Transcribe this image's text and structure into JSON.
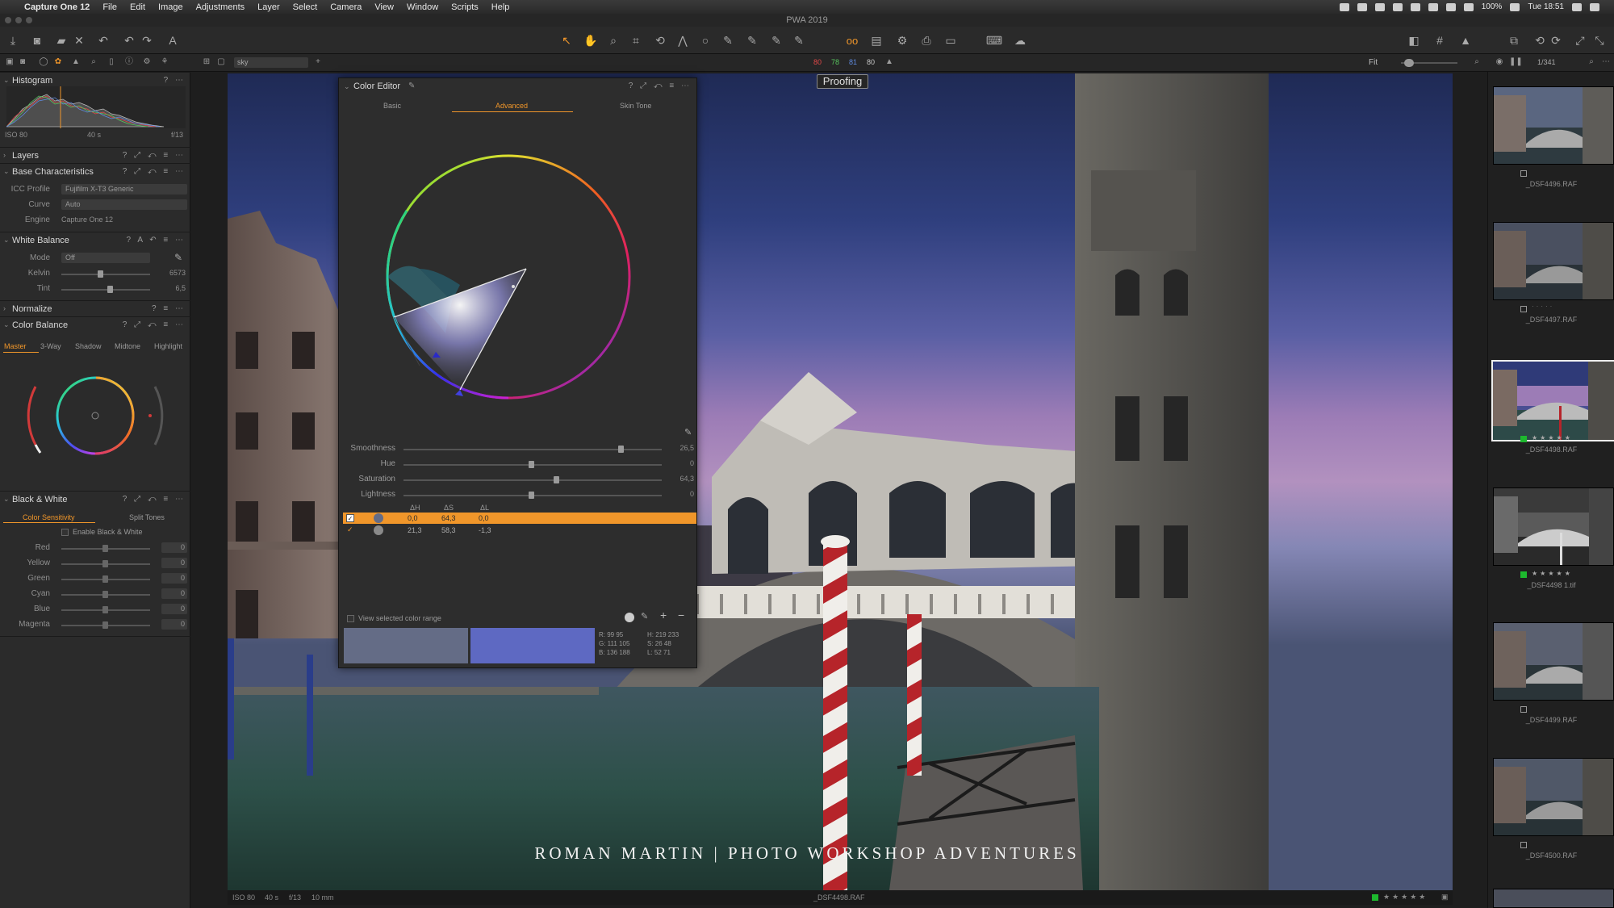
{
  "menubar": {
    "app_name": "Capture One 12",
    "items": [
      "File",
      "Edit",
      "Image",
      "Adjustments",
      "Layer",
      "Select",
      "Camera",
      "View",
      "Window",
      "Scripts",
      "Help"
    ],
    "battery": "100%",
    "clock": "Tue 18:51"
  },
  "window": {
    "title": "PWA 2019"
  },
  "subbar": {
    "search_value": "sky",
    "clip_values": [
      "80",
      "78",
      "81",
      "80"
    ],
    "zoom_label": "Fit",
    "count": "1/341"
  },
  "histogram": {
    "title": "Histogram",
    "iso": "ISO 80",
    "shutter": "40 s",
    "aperture": "f/13"
  },
  "layers": {
    "title": "Layers"
  },
  "base_characteristics": {
    "title": "Base Characteristics",
    "icc_label": "ICC Profile",
    "icc_value": "Fujifilm X-T3 Generic",
    "curve_label": "Curve",
    "curve_value": "Auto",
    "engine_label": "Engine",
    "engine_value": "Capture One 12"
  },
  "white_balance": {
    "title": "White Balance",
    "mode_label": "Mode",
    "mode_value": "Off",
    "kelvin_label": "Kelvin",
    "kelvin_value": "6573",
    "tint_label": "Tint",
    "tint_value": "6,5"
  },
  "normalize": {
    "title": "Normalize"
  },
  "color_balance": {
    "title": "Color Balance",
    "tabs": [
      "Master",
      "3-Way",
      "Shadow",
      "Midtone",
      "Highlight"
    ]
  },
  "black_white": {
    "title": "Black & White",
    "tabs": [
      "Color Sensitivity",
      "Split Tones"
    ],
    "enable_label": "Enable Black & White",
    "rows": [
      {
        "label": "Red",
        "value": "0"
      },
      {
        "label": "Yellow",
        "value": "0"
      },
      {
        "label": "Green",
        "value": "0"
      },
      {
        "label": "Cyan",
        "value": "0"
      },
      {
        "label": "Blue",
        "value": "0"
      },
      {
        "label": "Magenta",
        "value": "0"
      }
    ]
  },
  "proofing": {
    "label": "Proofing"
  },
  "color_editor": {
    "title": "Color Editor",
    "tabs": [
      "Basic",
      "Advanced",
      "Skin Tone"
    ],
    "sliders": [
      {
        "label": "Smoothness",
        "value": "26,5"
      },
      {
        "label": "Hue",
        "value": "0"
      },
      {
        "label": "Saturation",
        "value": "64,3"
      },
      {
        "label": "Lightness",
        "value": "0"
      }
    ],
    "columns": [
      "ΔH",
      "ΔS",
      "ΔL"
    ],
    "rows": [
      {
        "dh": "0,0",
        "ds": "64,3",
        "dl": "0,0"
      },
      {
        "dh": "21,3",
        "ds": "58,3",
        "dl": "-1,3"
      }
    ],
    "view_selected_label": "View selected color range",
    "readout": {
      "r": "R: 99  95",
      "g": "G: 111 105",
      "b": "B: 136 188",
      "h": "H: 219 233",
      "s": "S: 26  48",
      "l": "L: 52  71"
    },
    "swatch_before": "#646c86",
    "swatch_after": "#5e69c2"
  },
  "viewer_status": {
    "iso": "ISO 80",
    "shutter": "40 s",
    "aperture": "f/13",
    "focal": "10 mm",
    "filename": "_DSF4498.RAF"
  },
  "watermark": "ROMAN MARTIN | PHOTO WORKSHOP ADVENTURES",
  "filmstrip": [
    {
      "name": "_DSF4496.RAF",
      "green": false
    },
    {
      "name": "_DSF4497.RAF",
      "green": false
    },
    {
      "name": "_DSF4498.RAF",
      "green": true,
      "selected": true
    },
    {
      "name": "_DSF4498 1.tif",
      "green": true
    },
    {
      "name": "_DSF4499.RAF",
      "green": false
    },
    {
      "name": "_DSF4500.RAF",
      "green": false
    }
  ],
  "colors": {
    "accent": "#f0962a",
    "panel": "#2b2b2b",
    "flag_green": "#1db82e"
  }
}
